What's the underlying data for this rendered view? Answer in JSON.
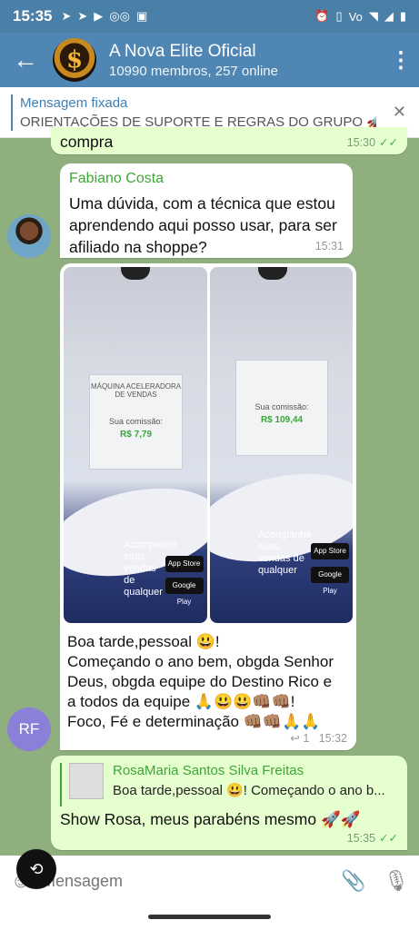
{
  "status": {
    "time": "15:35",
    "left_icons": [
      "telegram-icon",
      "telegram-icon",
      "youtube-icon",
      "voicemail-icon",
      "twitch-icon"
    ],
    "right_icons": [
      "alarm-icon",
      "vibrate-icon",
      "volte-icon",
      "wifi-icon",
      "signal-icon",
      "battery-icon"
    ]
  },
  "header": {
    "title": "A Nova Elite Oficial",
    "subtitle": "10990 membros, 257 online",
    "avatar_letter": "$"
  },
  "pinned": {
    "label": "Mensagem fixada",
    "text": "ORIENTAÇÕES DE SUPORTE E REGRAS DO GRUPO 🚀..."
  },
  "messages": {
    "m0": {
      "text": "compra",
      "time": "15:30"
    },
    "m1": {
      "sender": "Fabiano Costa",
      "text": "Uma dúvida, com a técnica que estou aprendendo aqui posso usar, para ser afiliado na shoppe?",
      "time": "15:31"
    },
    "m2": {
      "photo1": {
        "title": "MÁQUINA ACELERADORA DE VENDAS",
        "label": "Sua comissão:",
        "value": "R$ 7,79",
        "promo": "Acompanhe suas vendas de qualquer",
        "store1": "App Store",
        "store2": "Google Play"
      },
      "photo2": {
        "label": "Sua comissão:",
        "value": "R$ 109,44",
        "promo": "Acompanhe suas vendas de qualquer",
        "store1": "App Store",
        "store2": "Google Play"
      },
      "text_lines": [
        "Boa tarde,pessoal 😃!",
        "Começando o ano bem, obgda Senhor",
        "Deus, obgda equipe do Destino Rico e",
        "a todos da equipe 🙏😃😃👊🏽👊🏽!",
        "Foco, Fé e determinação 👊🏽👊🏽🙏🙏"
      ],
      "replies": "1",
      "time": "15:32",
      "avatar_initials": "RF"
    },
    "m3": {
      "reply_name": "RosaMaria Santos Silva Freitas",
      "reply_text": "Boa tarde,pessoal 😃! Começando o ano b...",
      "text": "Show Rosa, meus parabéns mesmo 🚀🚀",
      "time": "15:35"
    }
  },
  "input": {
    "placeholder": "Mensagem"
  }
}
